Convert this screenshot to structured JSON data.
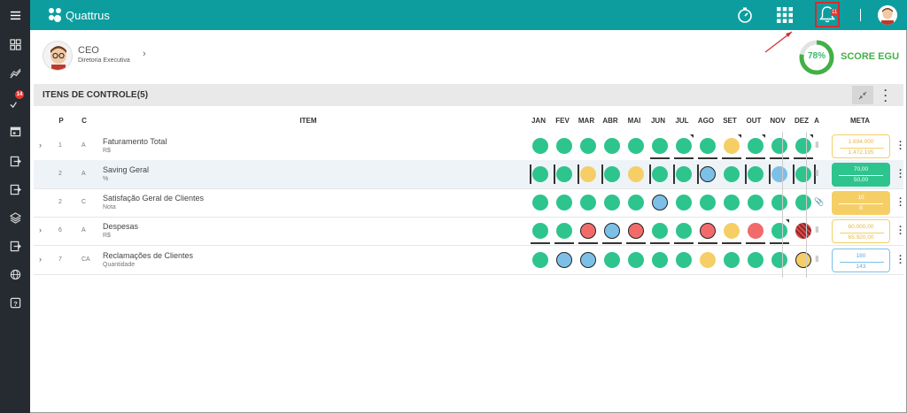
{
  "app": {
    "name": "Quattrus"
  },
  "notifications": {
    "count": "11"
  },
  "sidebar": {
    "badge": "14"
  },
  "header": {
    "role": "CEO",
    "department": "Diretoria Executiva",
    "score_pct": "78%",
    "score_label": "SCORE EGU",
    "score_value": 0.78
  },
  "section": {
    "title": "ITENS DE CONTROLE(5)"
  },
  "table": {
    "headers": {
      "p": "P",
      "c": "C",
      "item": "ITEM",
      "a": "A",
      "meta": "META"
    },
    "months": [
      "JAN",
      "FEV",
      "MAR",
      "ABR",
      "MAI",
      "JUN",
      "JUL",
      "AGO",
      "SET",
      "OUT",
      "NOV",
      "DEZ"
    ],
    "rows": [
      {
        "p": "1",
        "c": "A",
        "name": "Faturamento Total",
        "unit": "R$",
        "meta1": "1.694.000",
        "meta2": "1.472.195",
        "status": [
          "green",
          "green",
          "green",
          "green",
          "green",
          "green",
          "green",
          "green",
          "yellow",
          "green",
          "green",
          "green"
        ]
      },
      {
        "p": "2",
        "c": "A",
        "name": "Saving Geral",
        "unit": "%",
        "meta1": "70,00",
        "meta2": "50,00",
        "status": [
          "green",
          "green",
          "yellow",
          "green",
          "yellow",
          "green",
          "green",
          "blue",
          "green",
          "green",
          "blue",
          "green"
        ]
      },
      {
        "p": "2",
        "c": "C",
        "name": "Satisfação Geral de Clientes",
        "unit": "Nota",
        "meta1": "10",
        "meta2": "8",
        "status": [
          "green",
          "green",
          "green",
          "green",
          "green",
          "blue",
          "green",
          "green",
          "green",
          "green",
          "green",
          "green"
        ]
      },
      {
        "p": "6",
        "c": "A",
        "name": "Despesas",
        "unit": "R$",
        "meta1": "60.000,00",
        "meta2": "65.920,00",
        "status": [
          "green",
          "green",
          "red",
          "blue",
          "red",
          "green",
          "green",
          "red",
          "yellow",
          "red",
          "green",
          "striped-red"
        ]
      },
      {
        "p": "7",
        "c": "CA",
        "name": "Reclamações de Clientes",
        "unit": "Quantidade",
        "meta1": "180",
        "meta2": "143",
        "status": [
          "green",
          "blue",
          "blue",
          "green",
          "green",
          "green",
          "green",
          "yellow",
          "green",
          "green",
          "green",
          "yellow"
        ]
      }
    ]
  },
  "colors": {
    "teal": "#0e9d9f",
    "green": "#2ec48d",
    "yellow": "#f5cf66",
    "red": "#f26b6b",
    "blue": "#7cc0e8",
    "sidebar": "#262b31"
  }
}
